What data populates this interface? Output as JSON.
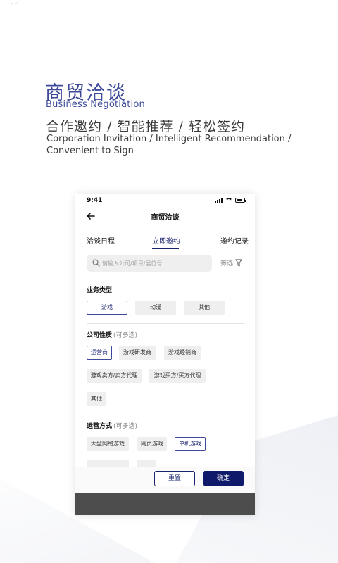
{
  "hero": {
    "title_cn": "商贸洽谈",
    "title_en": "Business Negotiation",
    "features_cn": "合作邀约 / 智能推荐 /  轻松签约",
    "features_en": "Corporation Invitation / Intelligent Recommendation / Convenient to Sign"
  },
  "phone": {
    "status_time": "9:41",
    "nav_title": "商贸洽谈",
    "tabs": [
      {
        "label": "洽谈日程",
        "active": false
      },
      {
        "label": "立即邀约",
        "active": true
      },
      {
        "label": "邀约记录",
        "active": false
      }
    ],
    "search": {
      "placeholder": "请输入公司/项目/展位号",
      "filter_label": "筛选"
    },
    "business_type": {
      "title": "业务类型",
      "options": [
        "游戏",
        "动漫",
        "其他"
      ],
      "selected": "游戏"
    },
    "company_nature": {
      "title": "公司性质",
      "hint": "(可多选)",
      "options": [
        "运营商",
        "游戏研发商",
        "游戏经销商",
        "游戏卖方/卖方代理",
        "游戏买方/买方代理",
        "其他"
      ],
      "selected": [
        "运营商"
      ]
    },
    "operation_mode": {
      "title": "运营方式",
      "hint": "(可多选)",
      "options": [
        "大型网络游戏",
        "网页游戏",
        "单机游戏"
      ],
      "selected": [
        "单机游戏"
      ]
    },
    "footer": {
      "reset_label": "重置",
      "confirm_label": "确定"
    }
  },
  "colors": {
    "brand_blue": "#3d4a9a",
    "primary_button": "#0f1a6b"
  }
}
